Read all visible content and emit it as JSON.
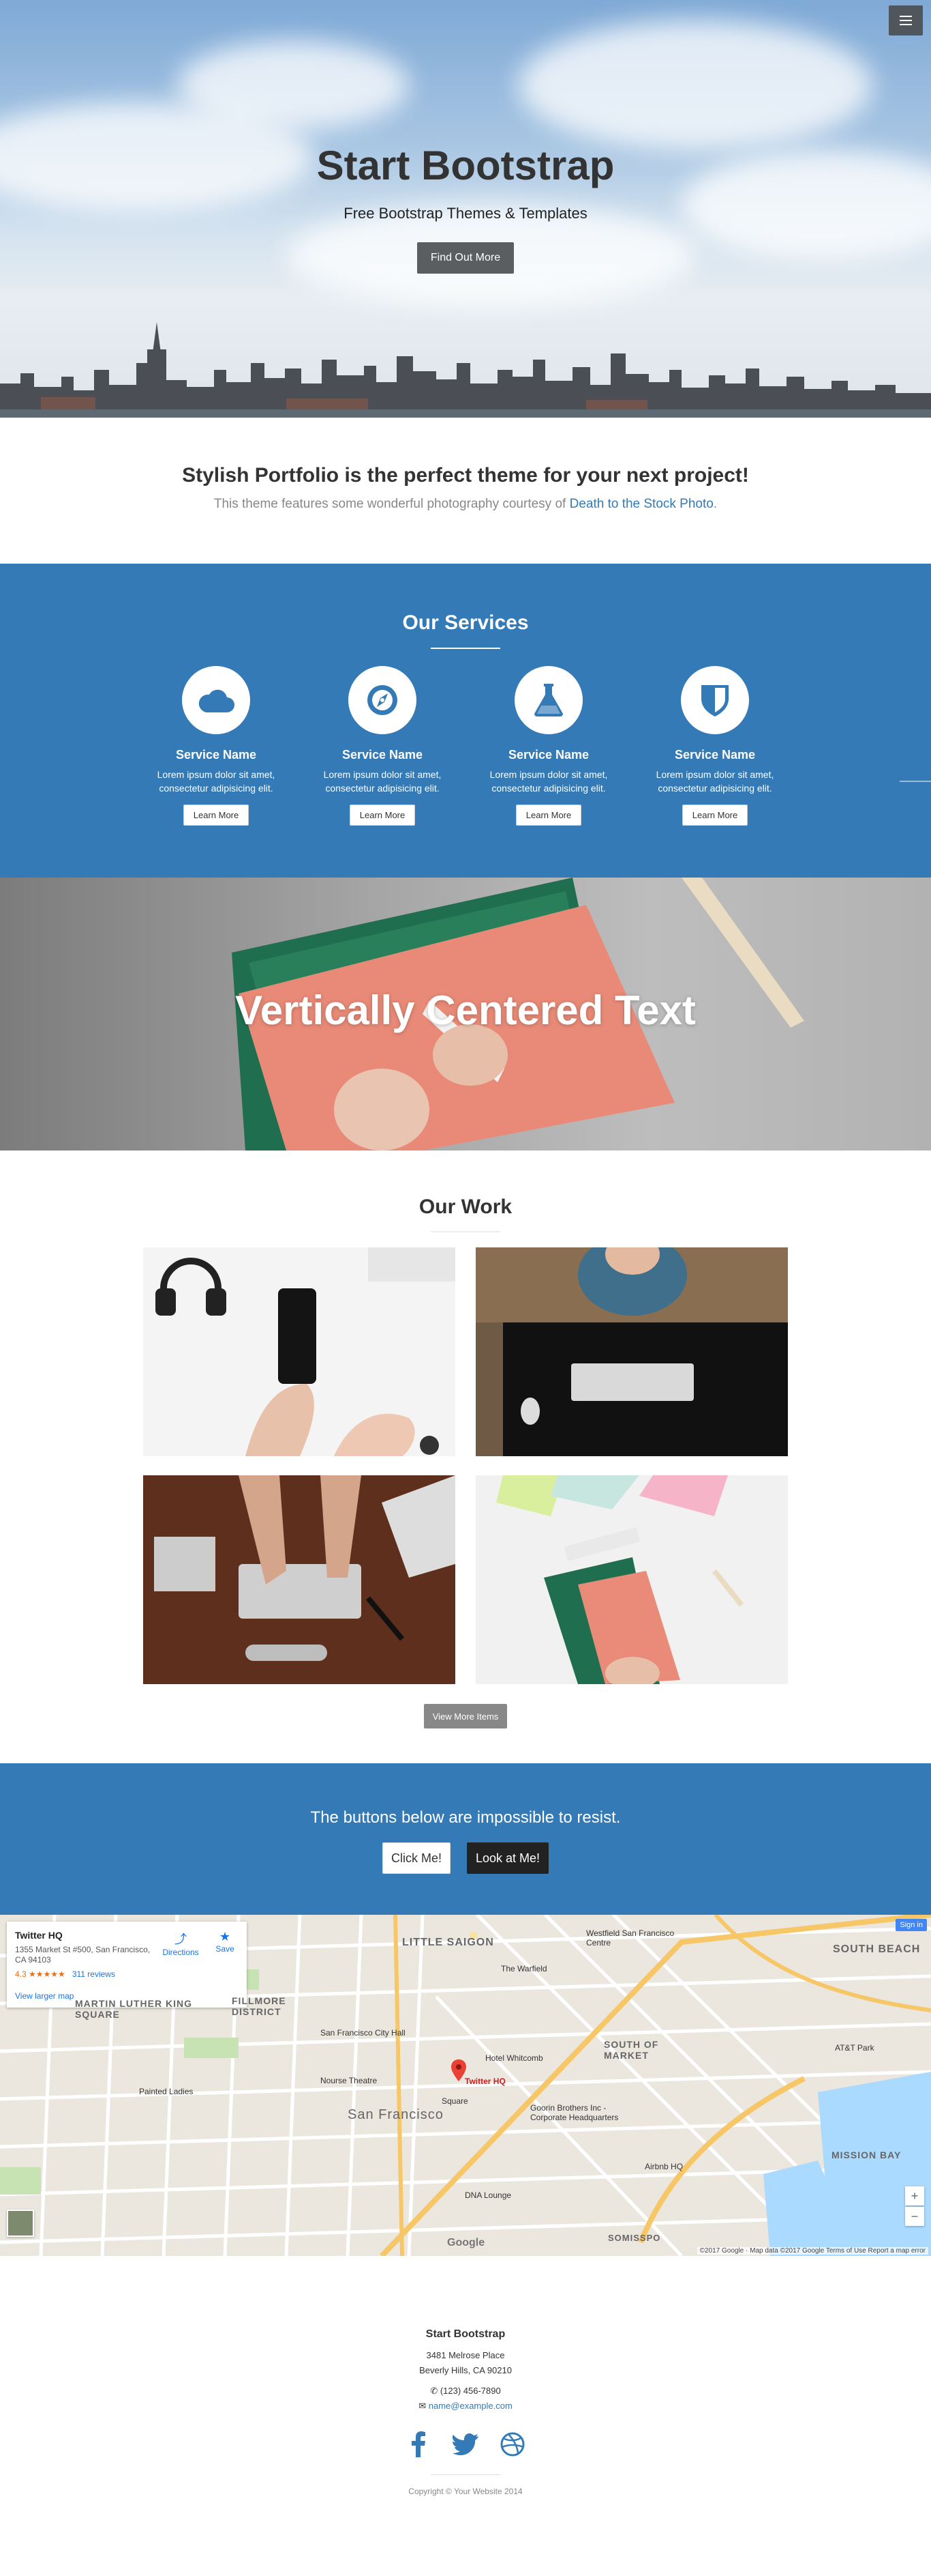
{
  "colors": {
    "primary": "#337ab7",
    "dark_button": "#222222",
    "hero_button": "#5a5e61"
  },
  "nav": {
    "menu_icon": "hamburger-icon"
  },
  "hero": {
    "title": "Start Bootstrap",
    "subtitle": "Free Bootstrap Themes & Templates",
    "button": "Find Out More"
  },
  "about": {
    "heading": "Stylish Portfolio is the perfect theme for your next project!",
    "text_before": "This theme features some wonderful photography courtesy of ",
    "link": "Death to the Stock Photo",
    "text_after": "."
  },
  "services": {
    "title": "Our Services",
    "items": [
      {
        "icon": "cloud-icon",
        "name": "Service Name",
        "desc": "Lorem ipsum dolor sit amet, consectetur adipisicing elit.",
        "button": "Learn More"
      },
      {
        "icon": "compass-icon",
        "name": "Service Name",
        "desc": "Lorem ipsum dolor sit amet, consectetur adipisicing elit.",
        "button": "Learn More"
      },
      {
        "icon": "flask-icon",
        "name": "Service Name",
        "desc": "Lorem ipsum dolor sit amet, consectetur adipisicing elit.",
        "button": "Learn More"
      },
      {
        "icon": "shield-icon",
        "name": "Service Name",
        "desc": "Lorem ipsum dolor sit amet, consectetur adipisicing elit.",
        "button": "Learn More"
      }
    ]
  },
  "callout": {
    "text": "Vertically Centered Text"
  },
  "portfolio": {
    "title": "Our Work",
    "button": "View More Items"
  },
  "cta": {
    "text": "The buttons below are impossible to resist.",
    "button1": "Click Me!",
    "button2": "Look at Me!"
  },
  "map": {
    "place_name": "Twitter HQ",
    "address": "1355 Market St #500, San Francisco, CA 94103",
    "rating": "4.3 ★★★★★",
    "reviews": "311 reviews",
    "larger_map": "View larger map",
    "directions": "Directions",
    "save": "Save",
    "sign_in": "Sign in",
    "labels": {
      "little_saigon": "LITTLE SAIGON",
      "westfield": "Westfield San Francisco Centre",
      "south_beach": "SOUTH BEACH",
      "mlk": "MARTIN LUTHER KING SQUARE",
      "fillmore": "FILLMORE DISTRICT",
      "warfield": "The Warfield",
      "city_hall": "San Francisco City Hall",
      "south_of_market": "SOUTH OF MARKET",
      "att_park": "AT&T Park",
      "hotel": "Hotel Whitcomb",
      "nourse": "Nourse Theatre",
      "twitter_pin": "Twitter HQ",
      "painted_ladies": "Painted Ladies",
      "square": "Square",
      "sf": "San Francisco",
      "goorin": "Goorin Brothers Inc - Corporate Headquarters",
      "mission_bay": "MISSION BAY",
      "airbnb": "Airbnb HQ",
      "dna": "DNA Lounge",
      "google": "Google",
      "somisspo": "SOMISSPO",
      "footer": "©2017 Google · Map data ©2017 Google    Terms of Use    Report a map error"
    }
  },
  "footer": {
    "title": "Start Bootstrap",
    "address1": "3481 Melrose Place",
    "address2": "Beverly Hills, CA 90210",
    "phone": "(123) 456-7890",
    "email": "name@example.com",
    "copyright": "Copyright © Your Website 2014"
  }
}
